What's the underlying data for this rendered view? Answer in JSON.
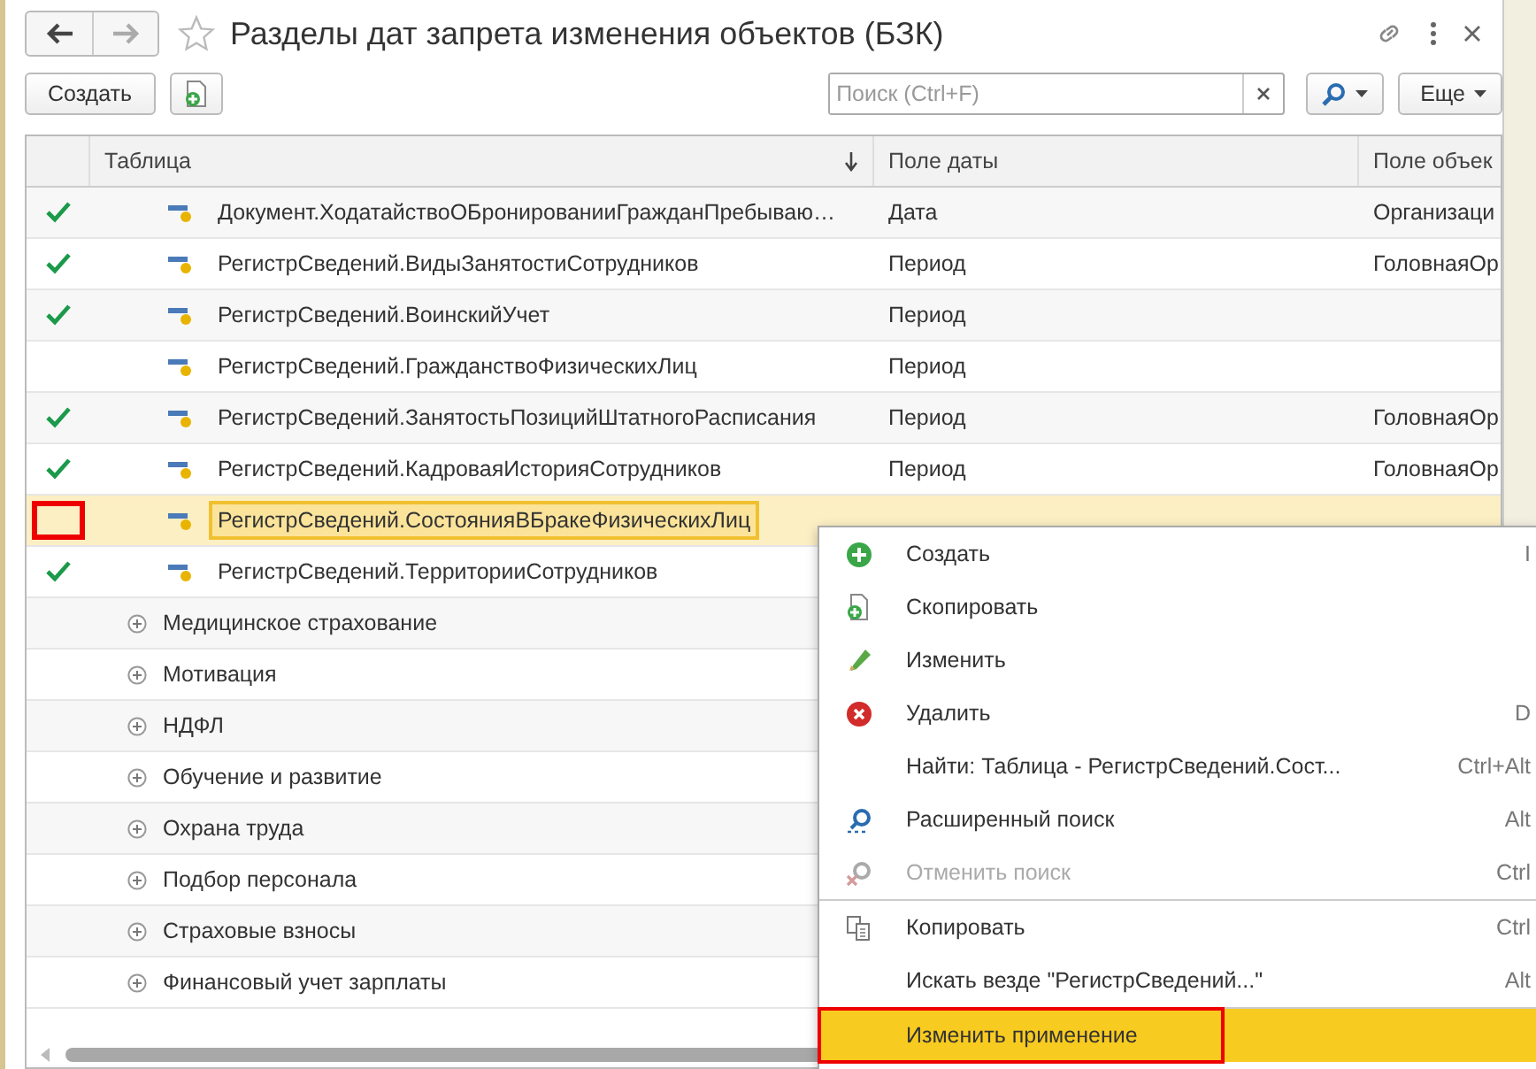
{
  "window": {
    "title": "Разделы дат запрета изменения объектов (БЗК)",
    "favorite": false
  },
  "toolbar": {
    "create_button": "Создать",
    "search": {
      "placeholder": "Поиск (Ctrl+F)"
    },
    "more_button": "Еще"
  },
  "table": {
    "columns": [
      {
        "label": "Таблица",
        "sorted": true
      },
      {
        "label": "Поле даты"
      },
      {
        "label": "Поле объек"
      }
    ],
    "rows": [
      {
        "kind": "item",
        "checked": true,
        "selected": false,
        "highlighted": false,
        "table": "Документ.ХодатайствоОБронированииГражданПребываю…",
        "date_field": "Дата",
        "object_field": "Организаци"
      },
      {
        "kind": "item",
        "checked": true,
        "selected": false,
        "highlighted": false,
        "table": "РегистрСведений.ВидыЗанятостиСотрудников",
        "date_field": "Период",
        "object_field": "ГоловнаяОр"
      },
      {
        "kind": "item",
        "checked": true,
        "selected": false,
        "highlighted": false,
        "table": "РегистрСведений.ВоинскийУчет",
        "date_field": "Период"
      },
      {
        "kind": "item",
        "checked": false,
        "selected": false,
        "highlighted": false,
        "table": "РегистрСведений.ГражданствоФизическихЛиц",
        "date_field": "Период"
      },
      {
        "kind": "item",
        "checked": true,
        "selected": false,
        "highlighted": false,
        "table": "РегистрСведений.ЗанятостьПозицийШтатногоРасписания",
        "date_field": "Период",
        "object_field": "ГоловнаяОр"
      },
      {
        "kind": "item",
        "checked": true,
        "selected": false,
        "highlighted": false,
        "table": "РегистрСведений.КадроваяИсторияСотрудников",
        "date_field": "Период",
        "object_field": "ГоловнаяОр"
      },
      {
        "kind": "item",
        "checked": false,
        "selected": true,
        "highlighted": true,
        "table": "РегистрСведений.СостоянияВБракеФизическихЛиц"
      },
      {
        "kind": "item",
        "checked": true,
        "selected": false,
        "highlighted": false,
        "table": "РегистрСведений.ТерриторииСотрудников"
      },
      {
        "kind": "group",
        "expanded": false,
        "title": "Медицинское страхование"
      },
      {
        "kind": "group",
        "expanded": false,
        "title": "Мотивация"
      },
      {
        "kind": "group",
        "expanded": false,
        "title": "НДФЛ"
      },
      {
        "kind": "group",
        "expanded": false,
        "title": "Обучение и развитие"
      },
      {
        "kind": "group",
        "expanded": false,
        "title": "Охрана труда"
      },
      {
        "kind": "group",
        "expanded": false,
        "title": "Подбор персонала"
      },
      {
        "kind": "group",
        "expanded": false,
        "title": "Страховые взносы"
      },
      {
        "kind": "group",
        "expanded": false,
        "title": "Финансовый учет зарплаты"
      }
    ]
  },
  "context_menu": {
    "items": [
      {
        "kind": "create",
        "label": "Создать",
        "shortcut": "I",
        "disabled": false,
        "selected": false,
        "highlighted": false
      },
      {
        "kind": "copy",
        "label": "Скопировать",
        "disabled": false,
        "selected": false,
        "highlighted": false
      },
      {
        "kind": "edit",
        "label": "Изменить",
        "disabled": false,
        "selected": false,
        "highlighted": false
      },
      {
        "kind": "delete",
        "label": "Удалить",
        "shortcut": "D",
        "disabled": false,
        "selected": false,
        "highlighted": false
      },
      {
        "kind": "plain",
        "label": "Найти: Таблица - РегистрСведений.Сост...",
        "shortcut": "Ctrl+Alt",
        "disabled": false,
        "selected": false,
        "highlighted": false
      },
      {
        "kind": "search",
        "label": "Расширенный поиск",
        "shortcut": "Alt",
        "disabled": false,
        "selected": false,
        "highlighted": false
      },
      {
        "kind": "cancel-search",
        "label": "Отменить поиск",
        "shortcut": "Ctrl",
        "disabled": true,
        "selected": false,
        "highlighted": false
      },
      {
        "kind": "separator"
      },
      {
        "kind": "clipboard",
        "label": "Копировать",
        "shortcut": "Ctrl",
        "disabled": false,
        "selected": false,
        "highlighted": false
      },
      {
        "kind": "plain",
        "label": "Искать везде \"РегистрСведений...\"",
        "shortcut": "Alt",
        "disabled": false,
        "selected": false,
        "highlighted": false
      },
      {
        "kind": "separator"
      },
      {
        "kind": "plain",
        "label": "Изменить применение",
        "disabled": false,
        "selected": true,
        "highlighted": true
      }
    ]
  }
}
